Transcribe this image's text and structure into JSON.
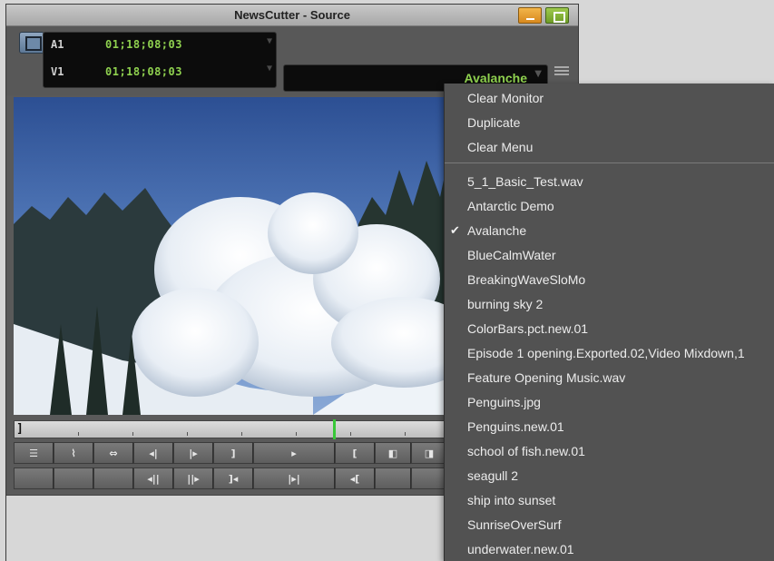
{
  "window": {
    "title": "NewsCutter - Source"
  },
  "timecode": {
    "rows": [
      {
        "track": "A1",
        "value": "01;18;08;03"
      },
      {
        "track": "V1",
        "value": "01;18;08;03"
      }
    ]
  },
  "clip": {
    "name": "Avalanche"
  },
  "colors": {
    "timecode_green": "#8fd14f",
    "playhead_green": "#38c838",
    "minimize_orange": "#e8a23a",
    "maximize_green": "#8ab83a"
  },
  "icons": {
    "monitor": "monitor-icon",
    "menu": "hamburger-menu-icon",
    "minimize": "minimize-icon",
    "maximize": "maximize-icon"
  },
  "controls": {
    "row1": [
      "",
      "",
      "",
      "◂|",
      "|▸",
      "]",
      "▸",
      "[",
      "◧",
      "◨"
    ],
    "row2": [
      "",
      "",
      "",
      "◂||",
      "||▸",
      "]◂",
      "|▸|",
      "◂[",
      "",
      ""
    ]
  },
  "menu": {
    "top_items": [
      "Clear Monitor",
      "Duplicate",
      "Clear Menu"
    ],
    "clips": [
      "5_1_Basic_Test.wav",
      "Antarctic Demo",
      "Avalanche",
      "BlueCalmWater",
      "BreakingWaveSloMo",
      "burning sky 2",
      "ColorBars.pct.new.01",
      "Episode 1 opening.Exported.02,Video Mixdown,1",
      "Feature Opening Music.wav",
      "Penguins.jpg",
      "Penguins.new.01",
      "school of fish.new.01",
      "seagull 2",
      "ship into sunset",
      "SunriseOverSurf",
      "underwater.new.01"
    ],
    "checked": "Avalanche"
  }
}
